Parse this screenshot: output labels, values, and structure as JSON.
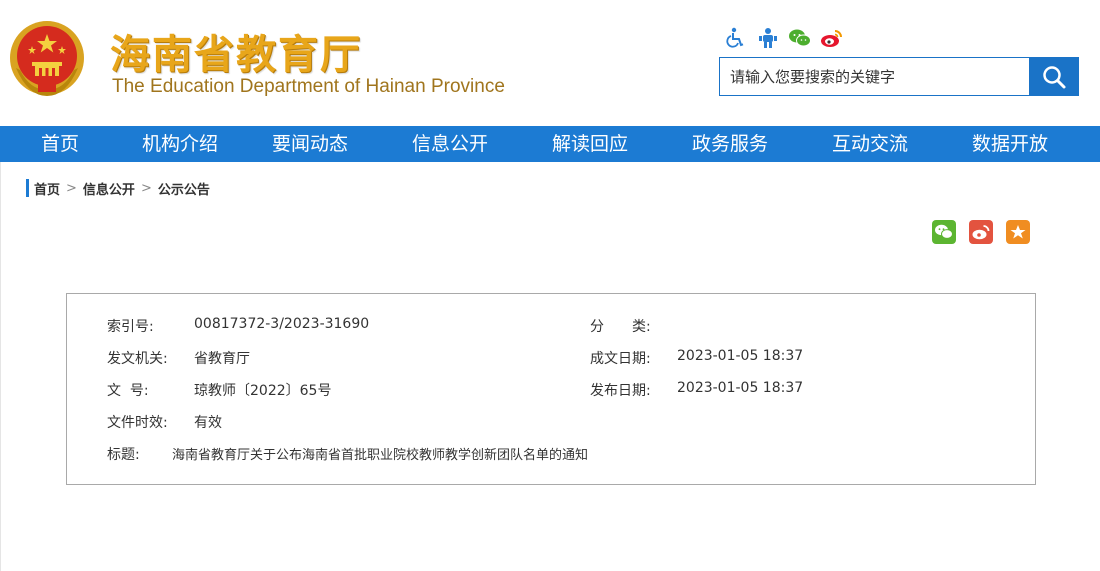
{
  "header": {
    "title_cn": "海南省教育厅",
    "title_en": "The Education Department of Hainan Province",
    "top_icons": [
      "accessibility-icon",
      "elder-mode-icon",
      "wechat-icon",
      "weibo-icon"
    ],
    "search": {
      "placeholder": "请输入您要搜索的关键字"
    },
    "colors": {
      "title": "#e8a61a",
      "subtitle": "#a0751d",
      "accent": "#1c7bd3"
    }
  },
  "nav": {
    "items": [
      "首页",
      "机构介绍",
      "要闻动态",
      "信息公开",
      "解读回应",
      "政务服务",
      "互动交流",
      "数据开放"
    ]
  },
  "breadcrumb": {
    "items": [
      "首页",
      "信息公开",
      "公示公告"
    ],
    "separator": ">"
  },
  "share": {
    "icons": [
      "wechat-share-icon",
      "weibo-share-icon",
      "favorite-icon"
    ],
    "colors": {
      "wechat": "#5cb531",
      "weibo": "#e3533f",
      "favorite": "#f08d21"
    }
  },
  "info": {
    "index_label": "索引号:",
    "index_value": "00817372-3/2023-31690",
    "category_label": "分　　类:",
    "category_value": "",
    "issuer_label": "发文机关:",
    "issuer_value": "省教育厅",
    "created_label": "成文日期:",
    "created_value": "2023-01-05 18:37",
    "docno_label": "文  号:",
    "docno_value": "琼教师〔2022〕65号",
    "published_label": "发布日期:",
    "published_value": "2023-01-05 18:37",
    "validity_label": "文件时效:",
    "validity_value": "有效",
    "title_label": "标题:",
    "title_value": "海南省教育厅关于公布海南省首批职业院校教师教学创新团队名单的通知"
  }
}
